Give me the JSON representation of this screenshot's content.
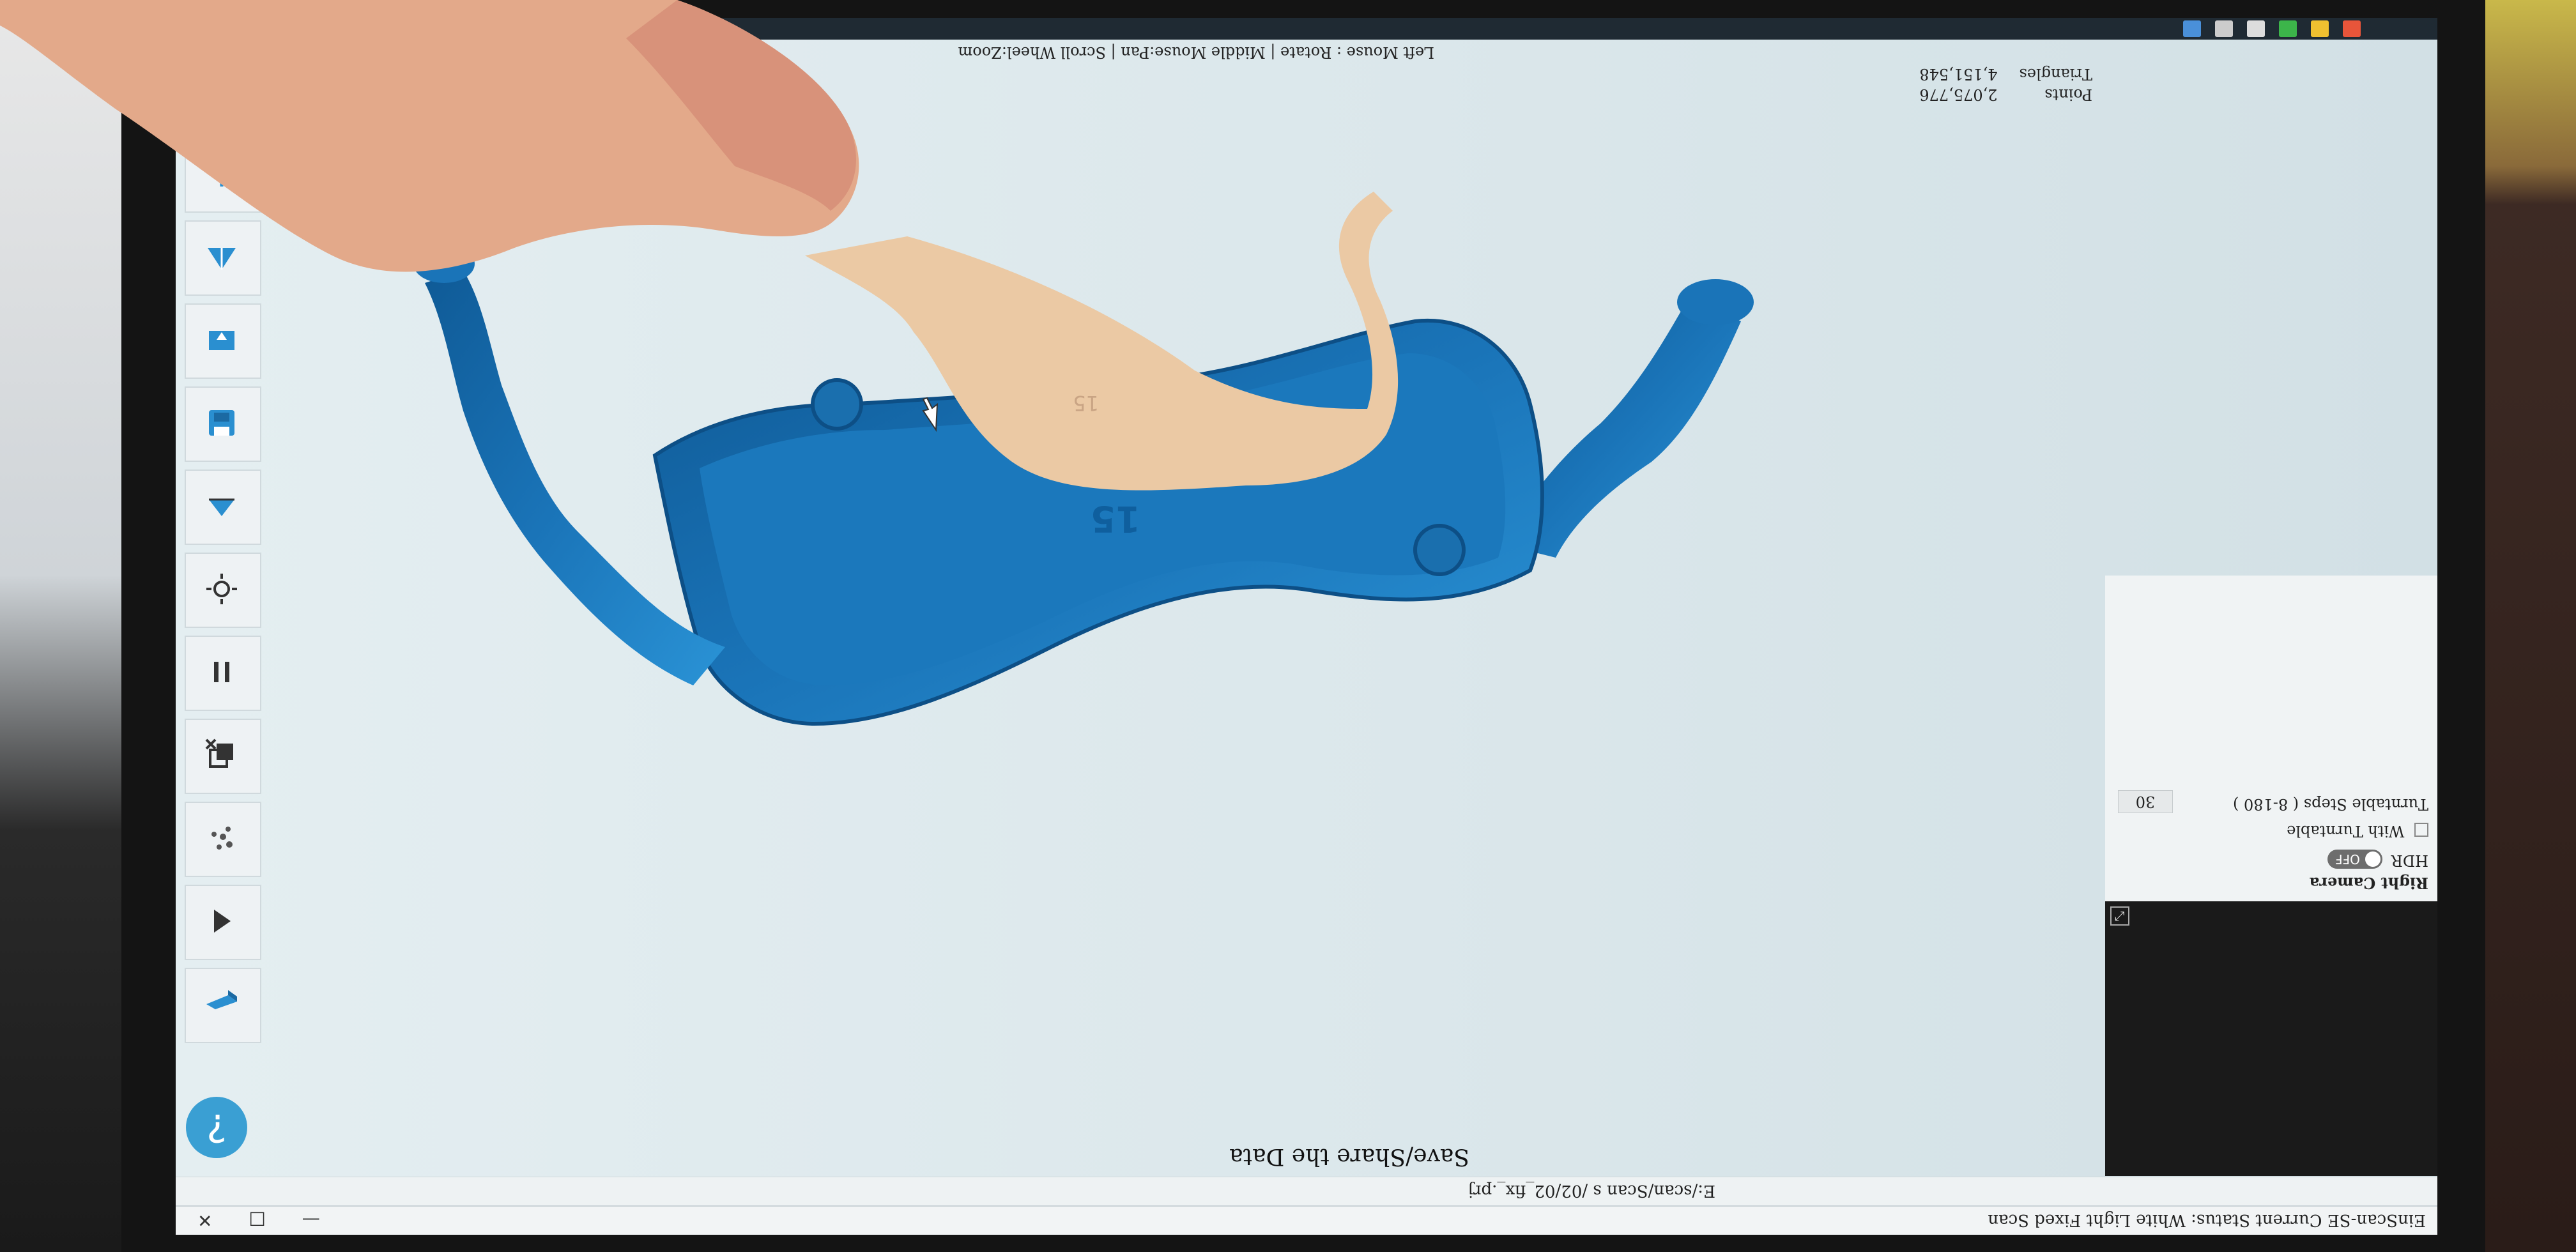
{
  "window": {
    "title": "EinScan-SE Current Status: White Light Fixed Scan",
    "controls": "— □ ✕"
  },
  "path": {
    "file": "E:/scan/Scan s /02/02_fix_.prj"
  },
  "step": {
    "title": "Save/Share the Data"
  },
  "camera_panel": {
    "label": "Right Camera",
    "hdr_label": "HDR",
    "hdr_state": "OFF",
    "turntable_label": "With Turntable",
    "steps_label": "Turntable Steps ( 8-180 )",
    "steps_value": "30",
    "close": "⤢"
  },
  "stats": {
    "points_label": "Points",
    "points_value": "2,075,776",
    "triangles_label": "Triangles",
    "triangles_value": "4,151,548"
  },
  "hint": "Left Mouse : Rotate | Middle Mouse:Pan | Scroll Wheel:Zoom",
  "model": {
    "engraving": "15",
    "color": "#1e7fc2"
  },
  "toolbar": {
    "help": "?"
  },
  "colors": {
    "accent": "#3a9fd3",
    "model_blue": "#1e7fc2",
    "viewport_bg": "#dbe7eb",
    "physical_model": "#e9c9a6"
  }
}
